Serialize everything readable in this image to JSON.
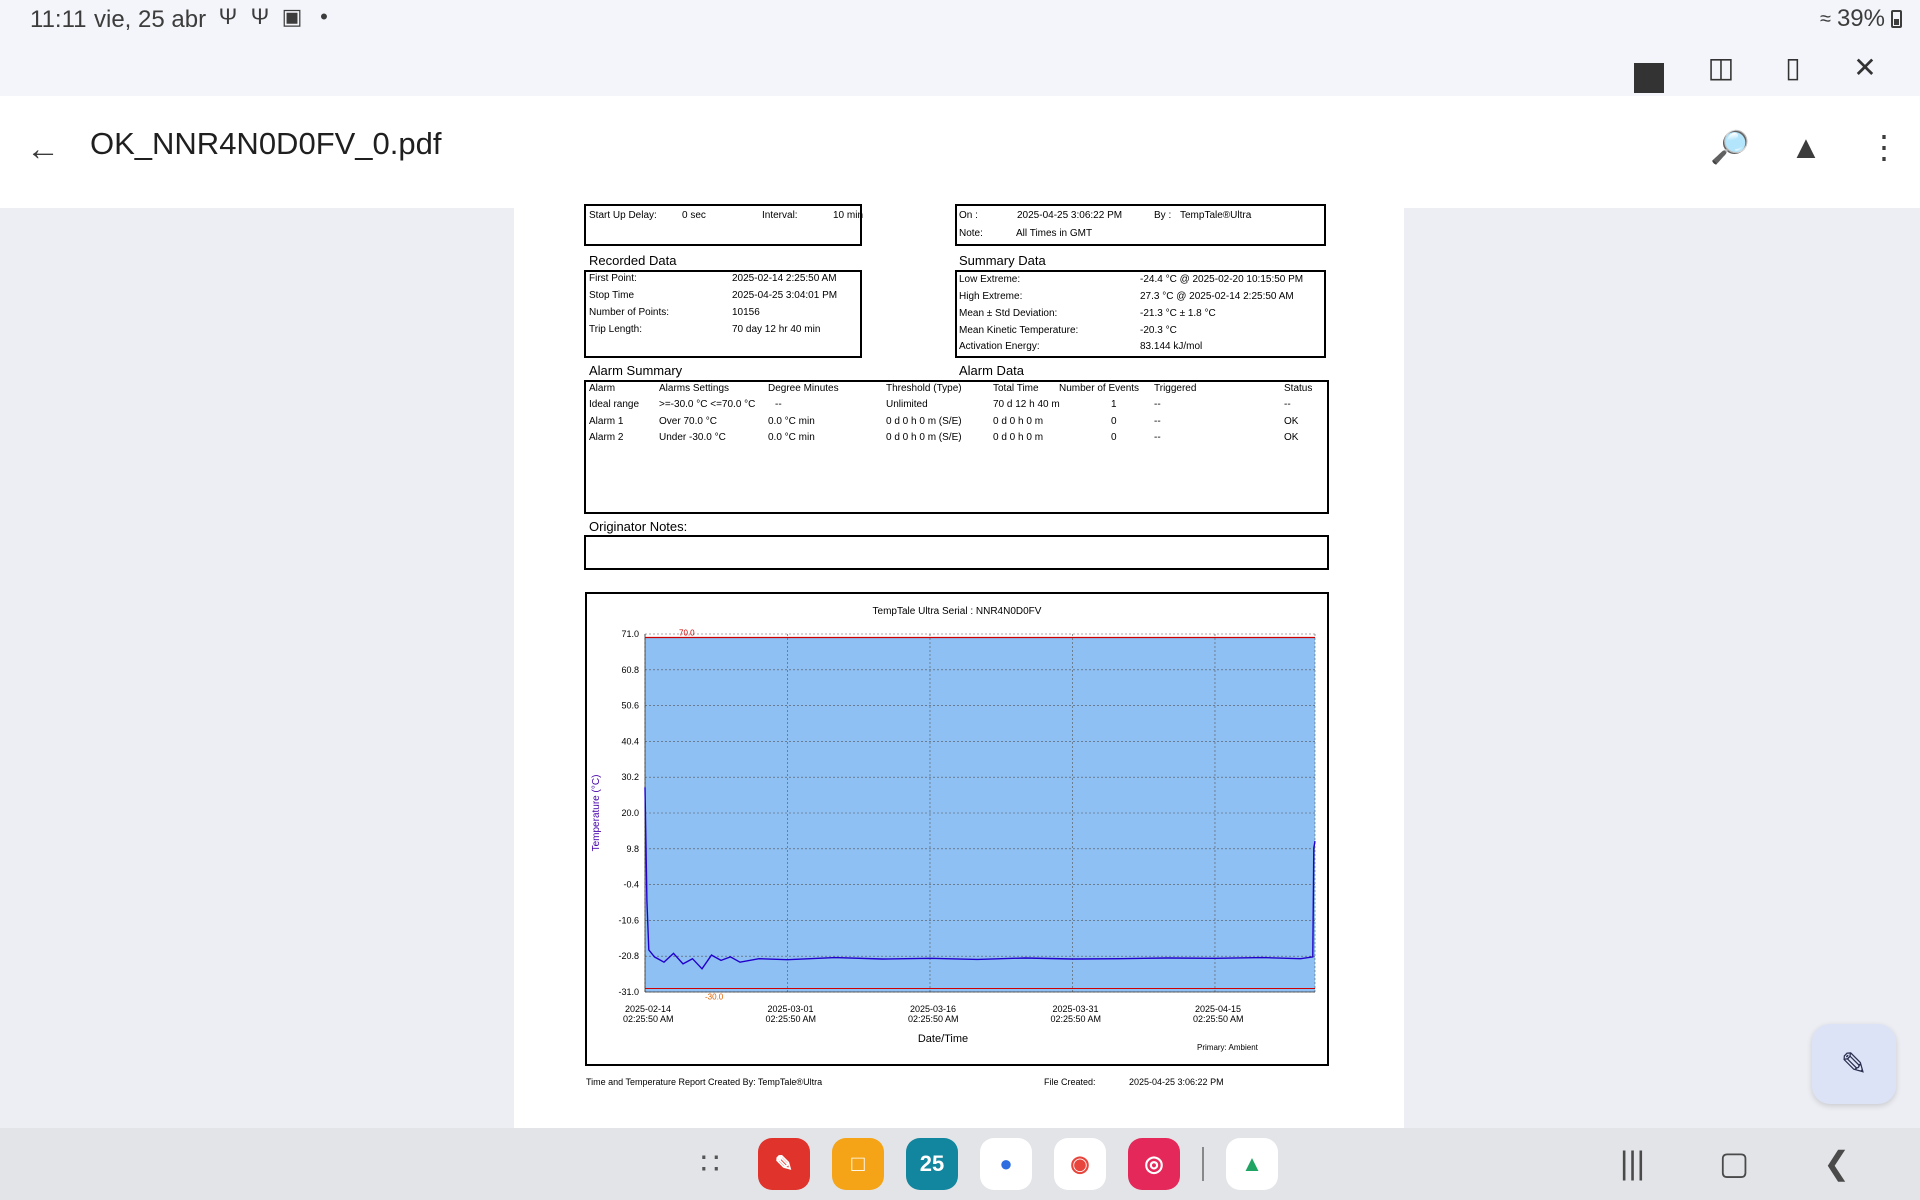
{
  "status_bar": {
    "time": "11:11",
    "date": "vie, 25 abr",
    "battery": "39%"
  },
  "app_bar": {
    "title": "OK_NNR4N0D0FV_0.pdf"
  },
  "report": {
    "header_left": {
      "startup_label": "Start Up Delay:",
      "startup_value": "0 sec",
      "interval_label": "Interval:",
      "interval_value": "10 min"
    },
    "header_right": {
      "on_label": "On :",
      "on_value": "2025-04-25  3:06:22 PM",
      "by_label": "By :",
      "by_value": "TempTale®Ultra",
      "note_label": "Note:",
      "note_value": "All Times in GMT"
    },
    "recorded_data": {
      "heading": "Recorded Data",
      "rows": [
        {
          "label": "First Point:",
          "value": "2025-02-14  2:25:50 AM"
        },
        {
          "label": "Stop Time",
          "value": "2025-04-25  3:04:01 PM"
        },
        {
          "label": "Number of Points:",
          "value": "10156"
        },
        {
          "label": "Trip Length:",
          "value": "70 day 12 hr 40 min"
        }
      ]
    },
    "summary_data": {
      "heading": "Summary Data",
      "rows": [
        {
          "label": "Low Extreme:",
          "value": "-24.4 °C @ 2025-02-20 10:15:50 PM"
        },
        {
          "label": "High Extreme:",
          "value": "27.3 °C @ 2025-02-14  2:25:50 AM"
        },
        {
          "label": "Mean ± Std Deviation:",
          "value": "-21.3 °C ± 1.8 °C"
        },
        {
          "label": "Mean Kinetic Temperature:",
          "value": "-20.3 °C"
        },
        {
          "label": "Activation Energy:",
          "value": "83.144 kJ/mol"
        }
      ]
    },
    "alarm_summary_heading": "Alarm Summary",
    "alarm_data_heading": "Alarm Data",
    "alarm_table": {
      "headers": [
        "Alarm",
        "Alarms Settings",
        "Degree Minutes",
        "Threshold (Type)",
        "Total Time",
        "Number of Events",
        "Triggered",
        "Status"
      ],
      "rows": [
        [
          "Ideal range",
          ">=-30.0 °C <=70.0 °C",
          "--",
          "Unlimited",
          "70 d 12 h 40 m",
          "1",
          "--",
          "--"
        ],
        [
          "Alarm 1",
          "Over 70.0 °C",
          "0.0 °C min",
          "0 d 0 h 0 m (S/E)",
          "0 d 0 h 0 m",
          "0",
          "--",
          "OK"
        ],
        [
          "Alarm 2",
          "Under -30.0 °C",
          "0.0 °C min",
          "0 d 0 h 0 m (S/E)",
          "0 d 0 h 0 m",
          "0",
          "--",
          "OK"
        ]
      ]
    },
    "originator_notes_label": "Originator Notes:",
    "footer": {
      "created_by": "Time and Temperature Report Created By:  TempTale®Ultra",
      "file_created_label": "File Created:",
      "file_created_value": "2025-04-25  3:06:22 PM"
    }
  },
  "chart_data": {
    "type": "line",
    "title": "TempTale Ultra  Serial : NNR4N0D0FV",
    "xlabel": "Date/Time",
    "ylabel": "Temperature     (°C)",
    "y_ticks": [
      "71.0",
      "60.8",
      "50.6",
      "40.4",
      "30.2",
      "20.0",
      "9.8",
      "-0.4",
      "-10.6",
      "-20.8",
      "-31.0"
    ],
    "ylim": [
      -31.0,
      71.0
    ],
    "x_ticks": [
      {
        "date": "2025-02-14",
        "time": "02:25:50 AM"
      },
      {
        "date": "2025-03-01",
        "time": "02:25:50 AM"
      },
      {
        "date": "2025-03-16",
        "time": "02:25:50 AM"
      },
      {
        "date": "2025-03-31",
        "time": "02:25:50 AM"
      },
      {
        "date": "2025-04-15",
        "time": "02:25:50 AM"
      }
    ],
    "xlim": [
      "2025-02-14 02:25:50",
      "2025-04-25 15:04:01"
    ],
    "upper_limit": 70.0,
    "upper_limit_label": "70.0",
    "lower_limit": -30.0,
    "lower_limit_label": "-30.0",
    "legend": "Primary: Ambient",
    "grid": true,
    "series": [
      {
        "name": "Ambient",
        "color": "#2200cc",
        "points": [
          [
            0.0,
            27.3
          ],
          [
            0.2,
            -5.0
          ],
          [
            0.4,
            -19.0
          ],
          [
            1.0,
            -21.0
          ],
          [
            2.0,
            -22.5
          ],
          [
            3.0,
            -20.0
          ],
          [
            4.0,
            -23.0
          ],
          [
            5.0,
            -21.5
          ],
          [
            6.0,
            -24.4
          ],
          [
            7.0,
            -20.5
          ],
          [
            8.0,
            -22.0
          ],
          [
            9.0,
            -21.0
          ],
          [
            10.0,
            -22.5
          ],
          [
            12.0,
            -21.5
          ],
          [
            15.0,
            -21.8
          ],
          [
            20.0,
            -21.2
          ],
          [
            25.0,
            -21.6
          ],
          [
            30.0,
            -21.4
          ],
          [
            35.0,
            -21.7
          ],
          [
            40.0,
            -21.3
          ],
          [
            45.0,
            -21.6
          ],
          [
            50.0,
            -21.5
          ],
          [
            55.0,
            -21.3
          ],
          [
            60.0,
            -21.4
          ],
          [
            65.0,
            -21.2
          ],
          [
            69.0,
            -21.5
          ],
          [
            70.3,
            -21.0
          ],
          [
            70.4,
            10.0
          ],
          [
            70.53,
            12.0
          ]
        ]
      }
    ],
    "colors": {
      "plot_fill": "#8ec0f4",
      "limit_line": "#cc0000",
      "lower_label": "#e06000"
    }
  }
}
